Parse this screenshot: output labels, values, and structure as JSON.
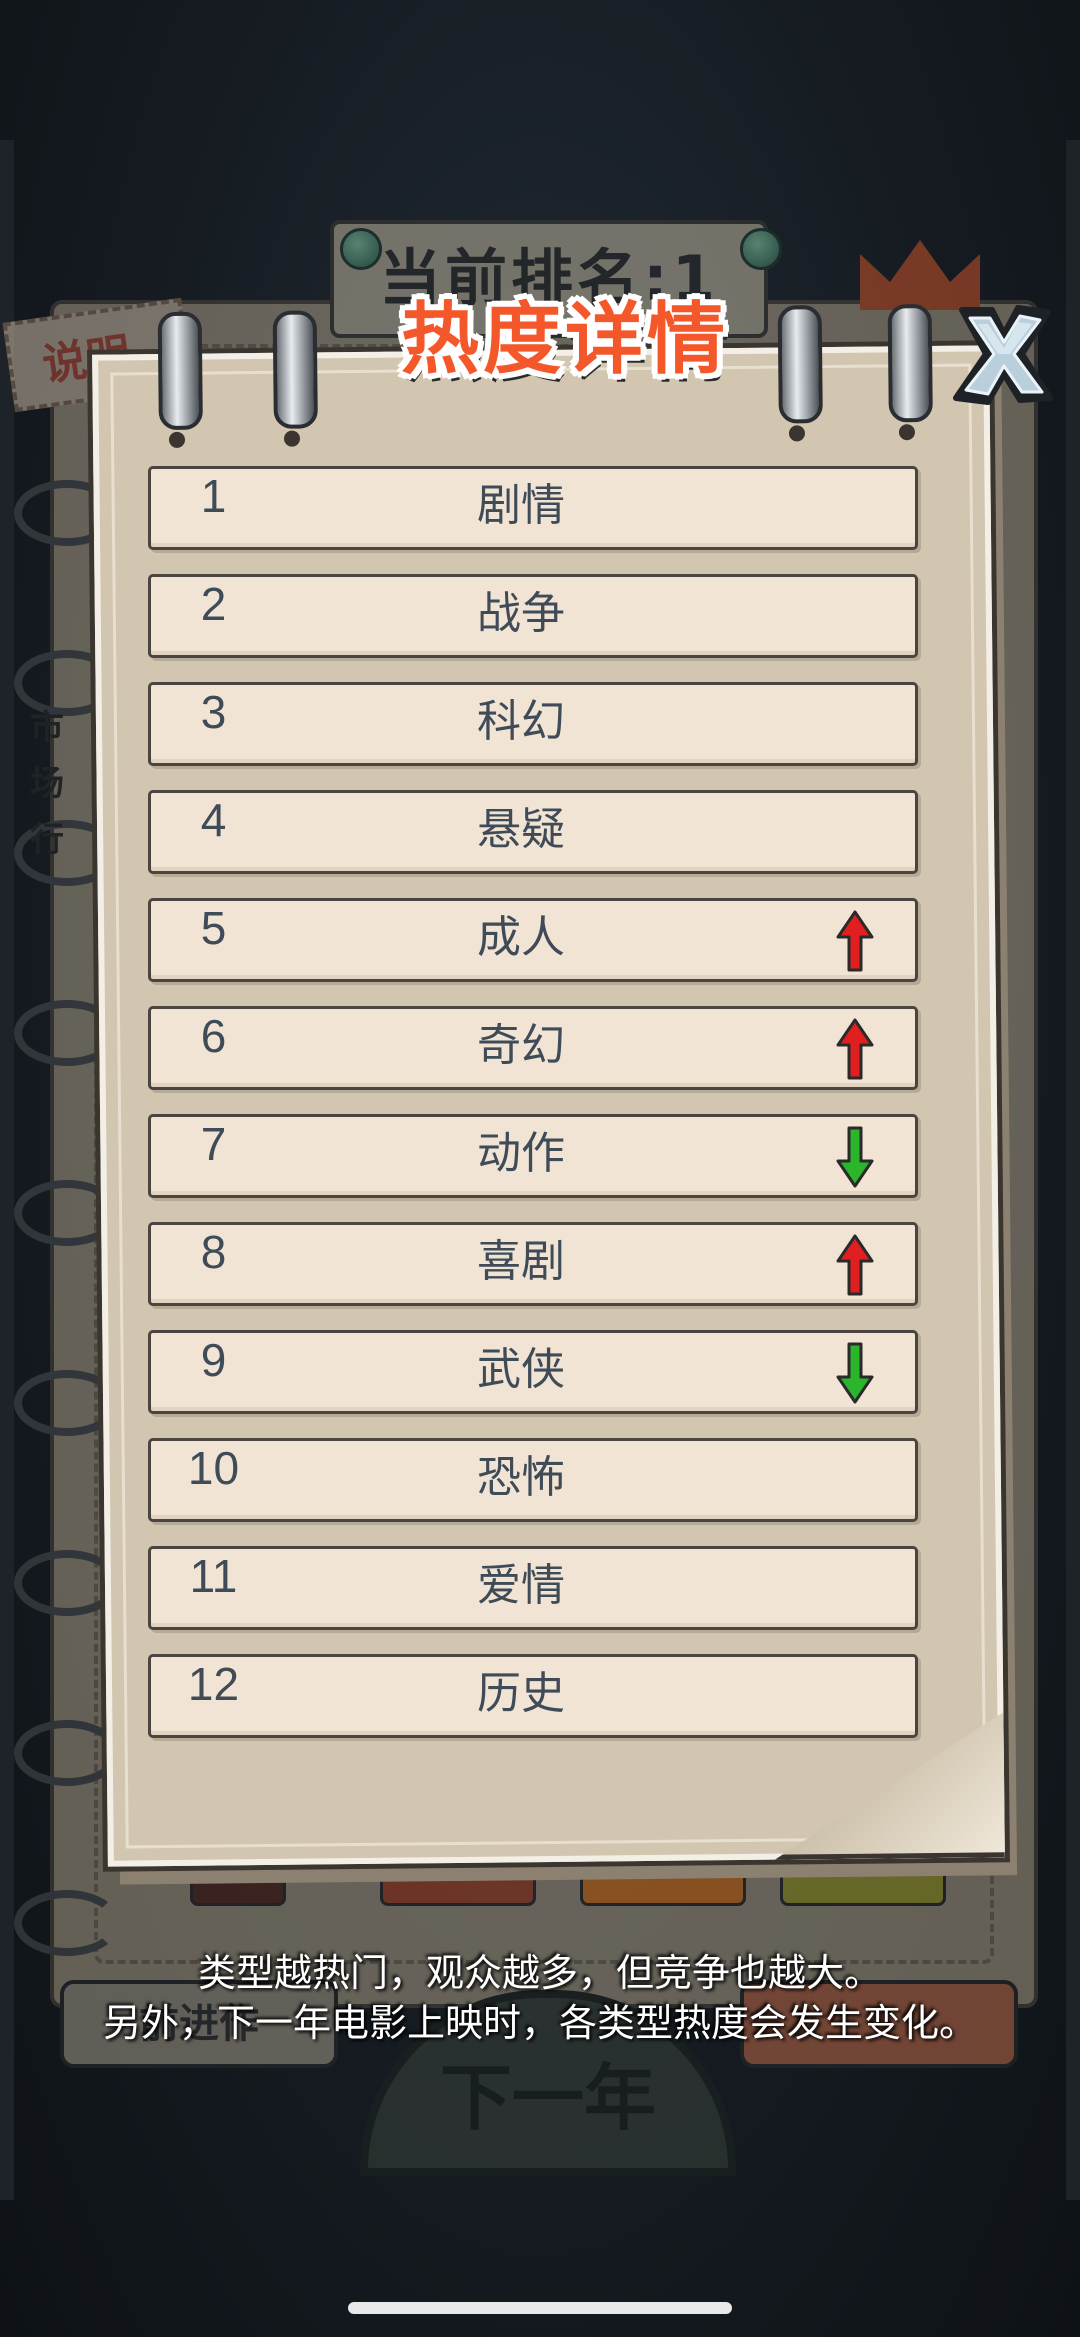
{
  "background": {
    "rank_banner": "当前排名:1",
    "explain_tag": "说明",
    "side_text": "市场行",
    "prev_button": "前进作",
    "next_year_button": "下一年"
  },
  "dialog": {
    "title": "热度详情",
    "close_icon": "close-x-icon",
    "rows": [
      {
        "rank": "1",
        "genre": "剧情",
        "trend": "none"
      },
      {
        "rank": "2",
        "genre": "战争",
        "trend": "none"
      },
      {
        "rank": "3",
        "genre": "科幻",
        "trend": "none"
      },
      {
        "rank": "4",
        "genre": "悬疑",
        "trend": "none"
      },
      {
        "rank": "5",
        "genre": "成人",
        "trend": "up"
      },
      {
        "rank": "6",
        "genre": "奇幻",
        "trend": "up"
      },
      {
        "rank": "7",
        "genre": "动作",
        "trend": "down"
      },
      {
        "rank": "8",
        "genre": "喜剧",
        "trend": "up"
      },
      {
        "rank": "9",
        "genre": "武侠",
        "trend": "down"
      },
      {
        "rank": "10",
        "genre": "恐怖",
        "trend": "none"
      },
      {
        "rank": "11",
        "genre": "爱情",
        "trend": "none"
      },
      {
        "rank": "12",
        "genre": "历史",
        "trend": "none"
      }
    ],
    "footer": {
      "line1": "类型越热门，观众越多，但竞争也越大。",
      "line2": "另外，下一年电影上映时，各类型热度会发生变化。"
    }
  },
  "colors": {
    "title": "#f4572a",
    "row_bg": "#f2e4d4",
    "row_text": "#3f4c58",
    "trend_up": "#e02020",
    "trend_down": "#2bb52b",
    "panel_bg": "#d2c6b1"
  }
}
